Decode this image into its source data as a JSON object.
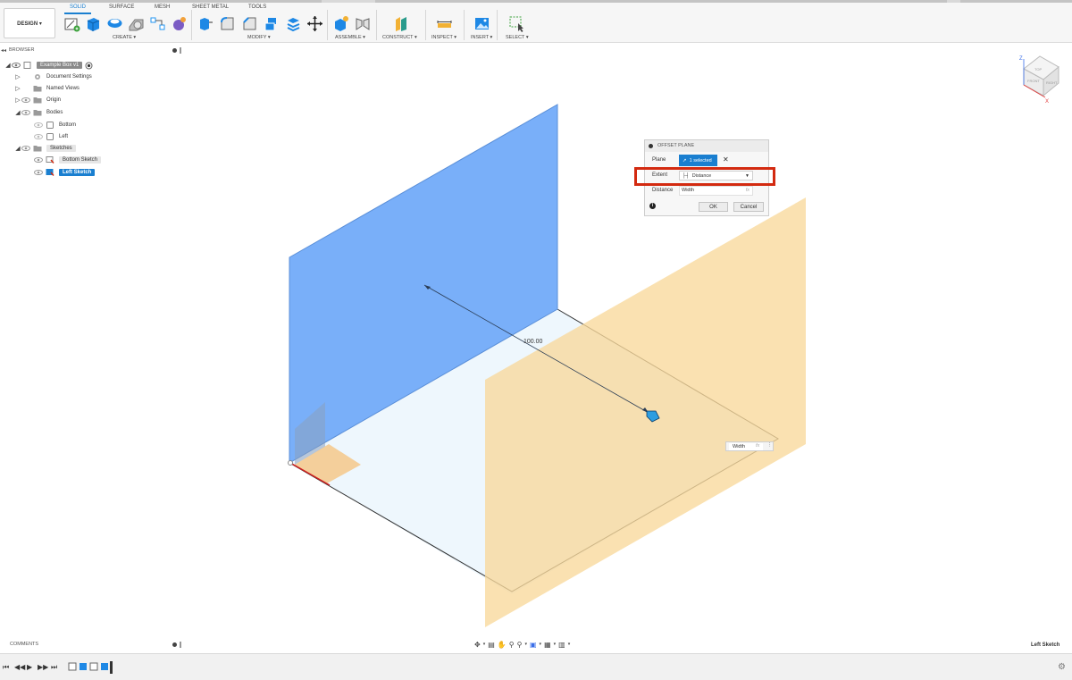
{
  "toolbar": {
    "workspace": "DESIGN ▾",
    "tabs": [
      "SOLID",
      "SURFACE",
      "MESH",
      "SHEET METAL",
      "TOOLS"
    ],
    "groups": [
      "CREATE ▾",
      "MODIFY ▾",
      "ASSEMBLE ▾",
      "CONSTRUCT ▾",
      "INSPECT ▾",
      "INSERT ▾",
      "SELECT ▾"
    ]
  },
  "browser": {
    "title": "BROWSER",
    "items": [
      {
        "label": "Example Box v1"
      },
      {
        "label": "Document Settings"
      },
      {
        "label": "Named Views"
      },
      {
        "label": "Origin"
      },
      {
        "label": "Bodies"
      },
      {
        "label": "Bottom"
      },
      {
        "label": "Left"
      },
      {
        "label": "Sketches"
      },
      {
        "label": "Bottom Sketch"
      },
      {
        "label": "Left Sketch"
      }
    ]
  },
  "dialog": {
    "title": "OFFSET PLANE",
    "plane_label": "Plane",
    "plane_value": "1 selected",
    "extent_label": "Extent",
    "extent_value": "Distance",
    "distance_label": "Distance",
    "distance_value": "Width",
    "fx": "fx",
    "ok": "OK",
    "cancel": "Cancel"
  },
  "viewport": {
    "dimension": "100.00",
    "width_input": "Width",
    "viewcube_faces": [
      "TOP",
      "FRONT",
      "RIGHT"
    ],
    "axis_labels": [
      "Z",
      "X"
    ]
  },
  "comments": {
    "title": "COMMENTS"
  },
  "status": {
    "active_sketch": "Left Sketch"
  },
  "colors": {
    "accent": "#1a7fd0",
    "blue_plane": "#6aa6f8",
    "orange_plane": "#fad9a0",
    "highlight": "#d32a10"
  }
}
